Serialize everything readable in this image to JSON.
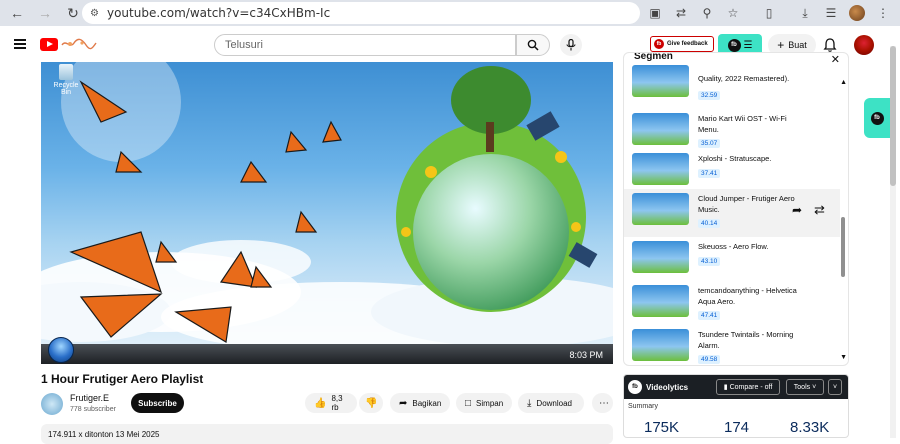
{
  "browser": {
    "url": "youtube.com/watch?v=c34CxHBm-Ic"
  },
  "header": {
    "search_placeholder": "Telusuri",
    "feedback_label": "Give feedback",
    "create_label": "Buat"
  },
  "player": {
    "recycle_label": "Recycle Bin",
    "clock": "8:03 PM"
  },
  "video": {
    "title": "1 Hour Frutiger Aero Playlist",
    "channel_name": "Frutiger.E",
    "subscribers": "778 subscriber",
    "subscribe_label": "Subscribe",
    "likes": "8,3 rb",
    "share_label": "Bagikan",
    "save_label": "Simpan",
    "download_label": "Download",
    "meta": "174.911 x ditonton  13 Mei 2025"
  },
  "segmen": {
    "title": "Segmen",
    "items": [
      {
        "title": "Quality, 2022 Remastered).",
        "time": "32.59"
      },
      {
        "title": "Mario Kart Wii OST - Wi-Fi Menu.",
        "time": "35.07"
      },
      {
        "title": "Xploshi - Stratuscape.",
        "time": "37.41"
      },
      {
        "title": "Cloud Jumper - Frutiger Aero Music.",
        "time": "40.14"
      },
      {
        "title": "Skeuoss - Aero Flow.",
        "time": "43.10"
      },
      {
        "title": "temcandoanything - Helvetica Aqua Aero.",
        "time": "47.41"
      },
      {
        "title": "Tsundere Twintails - Morning Alarm.",
        "time": "49.58"
      }
    ]
  },
  "videolytics": {
    "title": "Videolytics",
    "compare_label": "Compare - off",
    "tools_label": "Tools",
    "summary_label": "Summary",
    "stats": [
      "175K",
      "174",
      "8.33K"
    ]
  },
  "colors": {
    "accent_teal": "#3de2c5",
    "yt_red": "#ff0000",
    "link_blue": "#065fd4"
  }
}
